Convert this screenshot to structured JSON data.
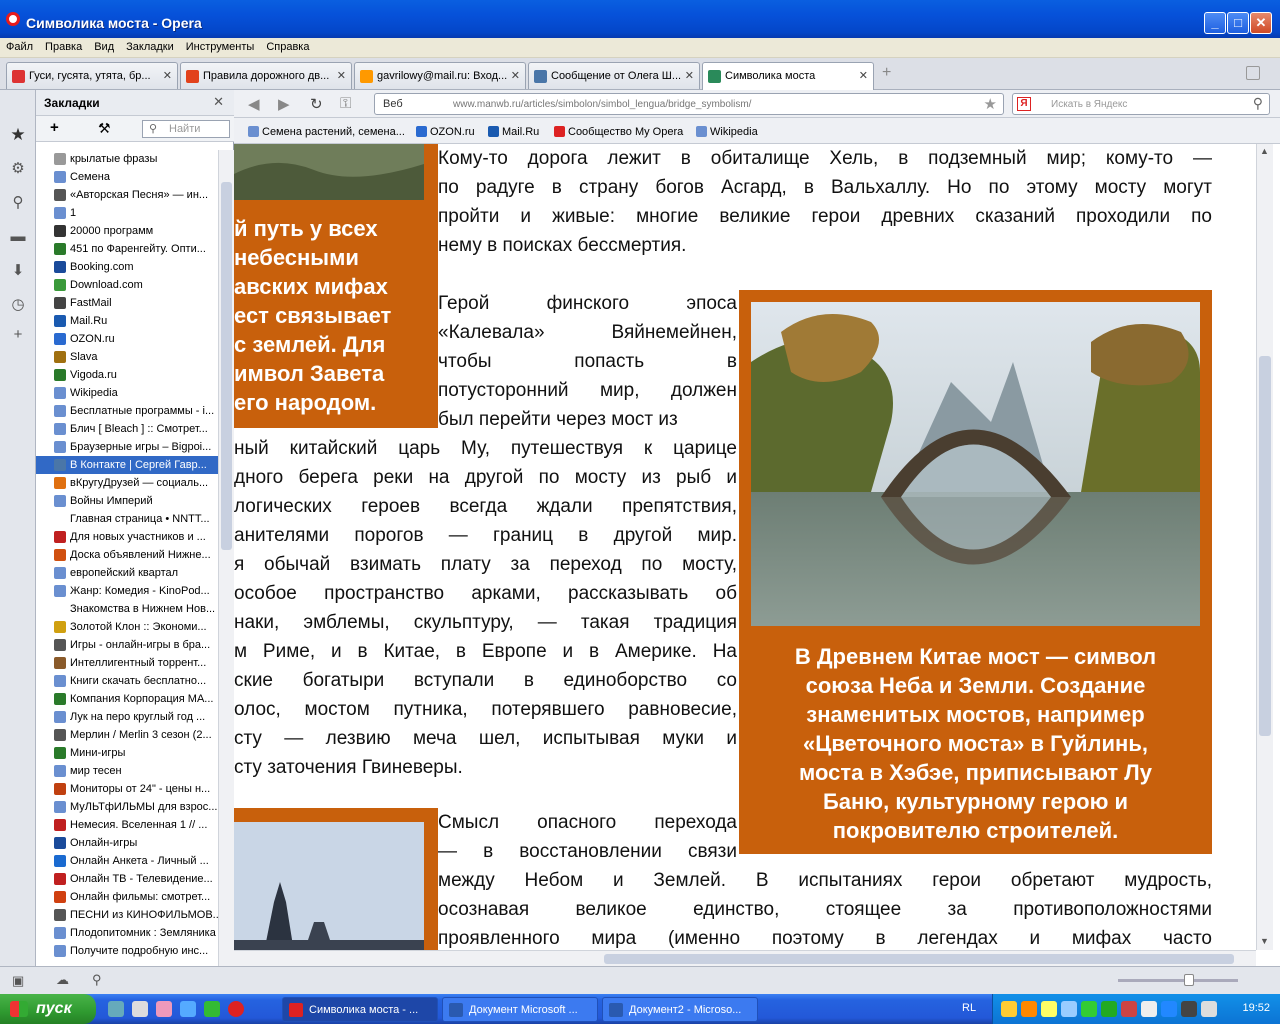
{
  "window": {
    "title": "Символика моста - Opera"
  },
  "menu": [
    "Файл",
    "Правка",
    "Вид",
    "Закладки",
    "Инструменты",
    "Справка"
  ],
  "tabs": [
    {
      "label": "Гуси, гусята, утята, бр...",
      "color": "#d33"
    },
    {
      "label": "Правила дорожного дв...",
      "color": "#e2421c"
    },
    {
      "label": "gavrilowy@mail.ru: Вход...",
      "color": "#f90"
    },
    {
      "label": "Сообщение от Олега Ш...",
      "color": "#4a76a8"
    },
    {
      "label": "Символика моста",
      "color": "#2a8a5a"
    }
  ],
  "panel": {
    "title": "Закладки",
    "search_placeholder": "Найти",
    "items": [
      {
        "label": "крылатые фразы",
        "color": "#999"
      },
      {
        "label": "Семена",
        "color": "#6a8fd0"
      },
      {
        "label": "«Авторская Песня» — ин...",
        "color": "#555"
      },
      {
        "label": "1",
        "color": "#6a8fd0"
      },
      {
        "label": "20000 программ",
        "color": "#333"
      },
      {
        "label": "451 по Фаренгейту. Опти...",
        "color": "#2a7a2a"
      },
      {
        "label": "Booking.com",
        "color": "#1a4a9a"
      },
      {
        "label": "Download.com",
        "color": "#3a9a3a"
      },
      {
        "label": "FastMail",
        "color": "#444"
      },
      {
        "label": "Mail.Ru",
        "color": "#1a5ab0"
      },
      {
        "label": "OZON.ru",
        "color": "#2a6ad0"
      },
      {
        "label": "Slava",
        "color": "#a07010"
      },
      {
        "label": "Vigoda.ru",
        "color": "#2a7a2a"
      },
      {
        "label": "Wikipedia",
        "color": "#6a8fd0"
      },
      {
        "label": "Бесплатные программы - i...",
        "color": "#6a8fd0"
      },
      {
        "label": "Блич [ Bleach ] :: Смотрет...",
        "color": "#6a8fd0"
      },
      {
        "label": "Браузерные игры – Bigpoi...",
        "color": "#6a8fd0"
      },
      {
        "label": "В Контакте | Сергей Гавр...",
        "color": "#4a76a8"
      },
      {
        "label": "вКругуДрузей — социаль...",
        "color": "#e07010"
      },
      {
        "label": "Войны Империй",
        "color": "#6a8fd0"
      },
      {
        "label": "Главная страница • NNTT...",
        "color": "#fff"
      },
      {
        "label": "Для новых участников и ...",
        "color": "#c02020"
      },
      {
        "label": "Доска объявлений Нижне...",
        "color": "#d05010"
      },
      {
        "label": "европейский квартал",
        "color": "#6a8fd0"
      },
      {
        "label": "Жанр: Комедия - KinoPod...",
        "color": "#6a8fd0"
      },
      {
        "label": "Знакомства в Нижнем Нов...",
        "color": "#fff"
      },
      {
        "label": "Золотой Клон :: Экономи...",
        "color": "#d0a010"
      },
      {
        "label": "Игры - онлайн-игры в бра...",
        "color": "#555"
      },
      {
        "label": "Интеллигентный торрент...",
        "color": "#8a5a2a"
      },
      {
        "label": "Книги скачать бесплатно...",
        "color": "#6a8fd0"
      },
      {
        "label": "Компания Корпорация МА...",
        "color": "#2a7a2a"
      },
      {
        "label": "Лук на перо круглый год ...",
        "color": "#6a8fd0"
      },
      {
        "label": "Мерлин / Merlin 3 сезон (2...",
        "color": "#555"
      },
      {
        "label": "Мини-игры",
        "color": "#2a7a2a"
      },
      {
        "label": "мир тесен",
        "color": "#6a8fd0"
      },
      {
        "label": "Мониторы от 24\" - цены н...",
        "color": "#c04010"
      },
      {
        "label": "МуЛЬТфИЛЬМЫ для взрос...",
        "color": "#6a8fd0"
      },
      {
        "label": "Немесия. Вселенная 1 // ...",
        "color": "#c02020"
      },
      {
        "label": "Онлайн-игры",
        "color": "#1a4a9a"
      },
      {
        "label": "Онлайн Анкета - Личный ...",
        "color": "#1a6ad0"
      },
      {
        "label": "Онлайн ТВ - Телевидение...",
        "color": "#c02020"
      },
      {
        "label": "Онлайн фильмы: смотрет...",
        "color": "#d04010"
      },
      {
        "label": "ПЕСНИ из КИНОФИЛЬМОВ...",
        "color": "#555"
      },
      {
        "label": "Плодопитомник : Земляника",
        "color": "#6a8fd0"
      },
      {
        "label": "Получите подробную инс...",
        "color": "#6a8fd0"
      },
      {
        "label": "Пункт Новой Мо...",
        "color": "#555"
      }
    ],
    "selected_index": 17
  },
  "nav": {
    "address_label": "Веб",
    "url": "www.manwb.ru/articles/simbolon/simbol_lengua/bridge_symbolism/",
    "search_placeholder": "Искать в Яндекс",
    "yandex_logo": "Я"
  },
  "bookmarks_bar": [
    {
      "label": "Семена растений, семена...",
      "color": "#6a8fd0"
    },
    {
      "label": "OZON.ru",
      "color": "#2a6ad0"
    },
    {
      "label": "Mail.Ru",
      "color": "#1a5ab0"
    },
    {
      "label": "Сообщество My Opera",
      "color": "#d22"
    },
    {
      "label": "Wikipedia",
      "color": "#6a8fd0"
    }
  ],
  "article": {
    "p1_lines": [
      "Кому-то дорога лежит в обиталище Хель, в подземный мир; кому-то —",
      "по радуге в страну богов Асгард, в Вальхаллу. Но по этому мосту могут",
      "пройти и живые: многие великие герои древних сказаний проходили по",
      "нему в поисках бессмертия."
    ],
    "p2_top_lines": [
      "Герой финского эпоса",
      "«Калевала» Вяйнемейнен,",
      "чтобы попасть в",
      "потусторонний мир, должен",
      "был перейти через мост из"
    ],
    "p2_cut_lines": [
      "ный китайский царь Му, путешествуя к царице",
      "дного берега реки на другой по мосту из рыб и",
      "логических героев всегда ждали препятствия,",
      "анителями порогов — границ в другой мир.",
      "я обычай взимать плату за переход по мосту,",
      "особое пространство арками, рассказывать об",
      "наки, эмблемы, скульптуру, — такая традиция",
      "м Риме, и в Китае, в Европе и в Америке. На",
      "ские богатыри вступали в единоборство со",
      "олос, мостом путника, потерявшего равновесие,",
      "сту — лезвию меча шел, испытывая муки и",
      "сту заточения Гвиневеры."
    ],
    "p3_lines": [
      "Смысл опасного перехода",
      "— в восстановлении связи",
      "между Небом и Землей. В испытаниях герои обретают мудрость,",
      "осознавая великое единство, стоящее за противоположностями",
      "проявленного мира (именно поэтому в легендах и мифах часто"
    ],
    "left_box_lines": [
      "й путь у всех",
      "небесными",
      "авских мифах",
      "ест связывает",
      " с землей. Для",
      "имвол Завета",
      "его народом."
    ],
    "right_caption_lines": [
      "В Древнем Китае мост — символ",
      "союза Неба и Земли. Создание",
      "знаменитых мостов, например",
      "«Цветочного моста» в Гуйлинь,",
      "моста в Хэбэе, приписывают Лу",
      "Баню, культурному герою и",
      "покровителю строителей."
    ],
    "accent_color": "#c8600c"
  },
  "taskbar": {
    "start_label": "пуск",
    "items": [
      {
        "label": "Символика моста - ...",
        "color": "#d22"
      },
      {
        "label": "Документ Microsoft ...",
        "color": "#2a5ab0"
      },
      {
        "label": "Документ2 - Microso...",
        "color": "#2a5ab0"
      }
    ],
    "lang": "RL",
    "clock": "19:52"
  }
}
